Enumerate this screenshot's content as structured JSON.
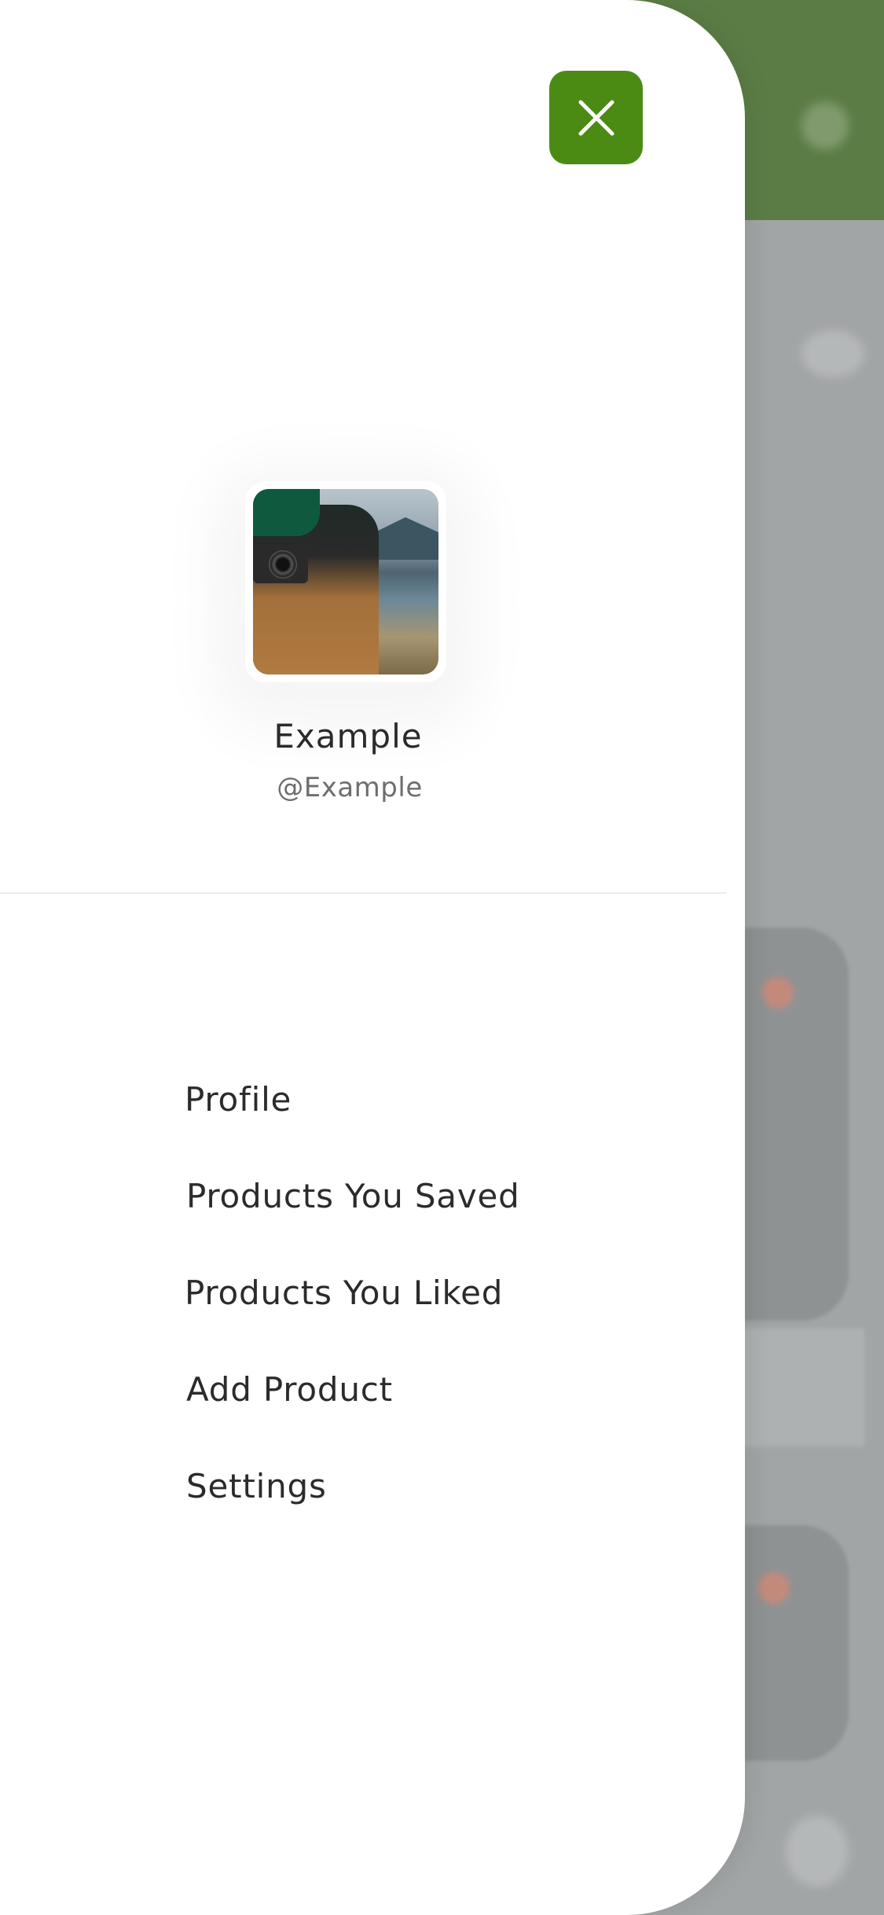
{
  "drawer": {
    "close_icon": "close-icon",
    "accent_color": "#4b8b14",
    "user": {
      "name": "Example",
      "handle": "@Example"
    },
    "menu": [
      {
        "label": "Profile"
      },
      {
        "label": "Products You Saved"
      },
      {
        "label": "Products You Liked"
      },
      {
        "label": "Add Product"
      },
      {
        "label": "Settings"
      }
    ]
  },
  "background": {
    "header_color": "#5b7d45",
    "heart_icon": "heart-icon"
  }
}
